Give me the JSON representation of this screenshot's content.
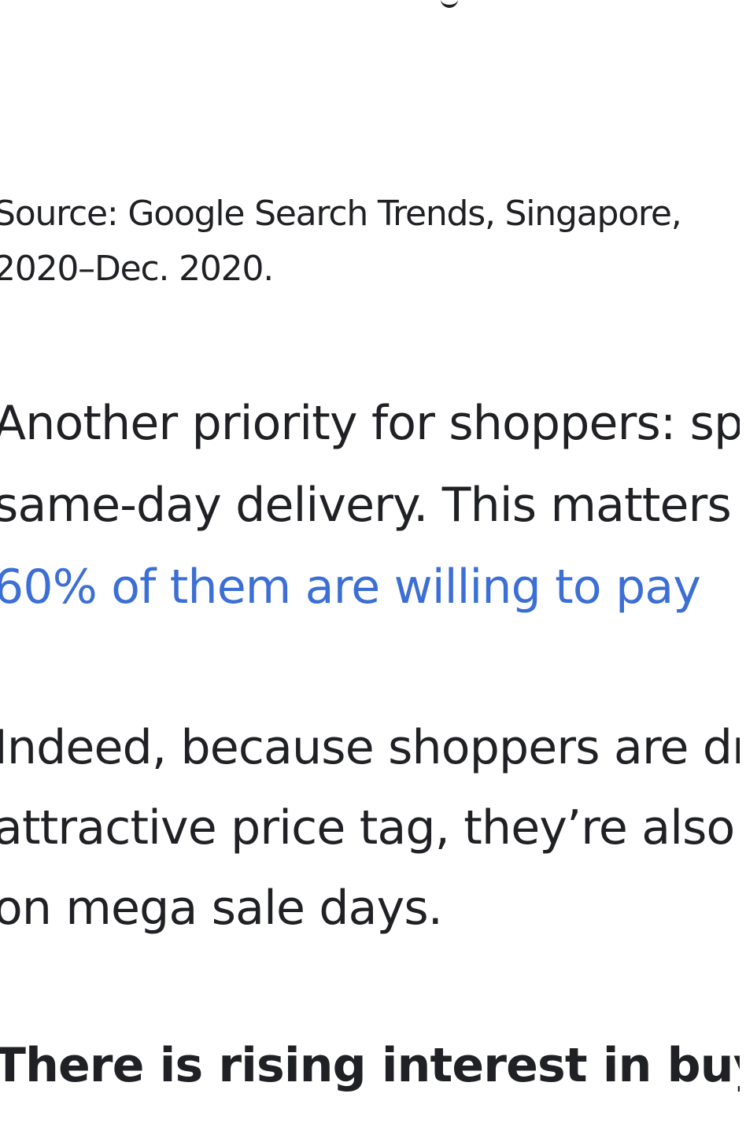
{
  "source_caption": {
    "line1": "Source: Google Search Trends, Singapore,",
    "line2": "2020–Dec. 2020."
  },
  "paragraph_delivery": {
    "line1": "Another priority for shoppers: speedy",
    "line2": "same-day delivery. This matters so much that",
    "link_line": "60% of them are willing to pay"
  },
  "paragraph_price": {
    "line1": "Indeed, because shoppers are drawn to an",
    "line2": "attractive price tag, they’re also",
    "line3": "on mega sale days."
  },
  "section_heading": "There is rising interest in buying"
}
